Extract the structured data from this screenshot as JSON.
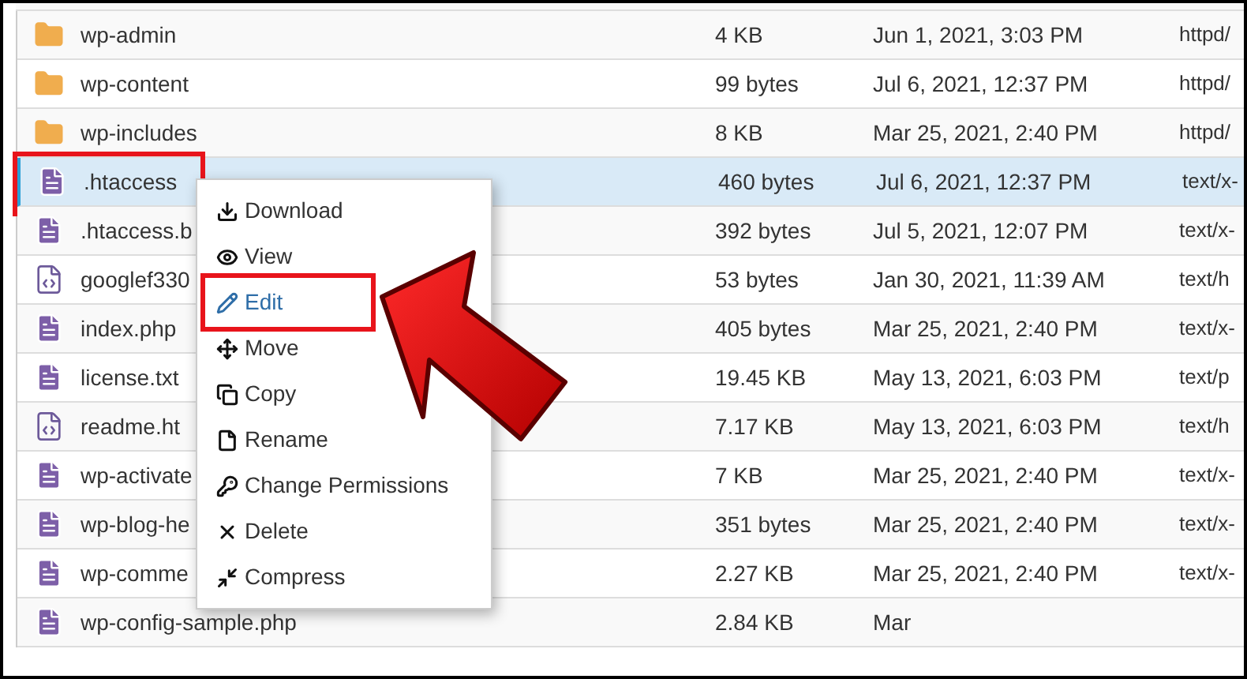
{
  "rows": [
    {
      "kind": "folder",
      "name": "wp-admin",
      "size": "4 KB",
      "date": "Jun 1, 2021, 3:03 PM",
      "type": "httpd/",
      "selected": false,
      "annotated": false
    },
    {
      "kind": "folder",
      "name": "wp-content",
      "size": "99 bytes",
      "date": "Jul 6, 2021, 12:37 PM",
      "type": "httpd/",
      "selected": false,
      "annotated": false
    },
    {
      "kind": "folder",
      "name": "wp-includes",
      "size": "8 KB",
      "date": "Mar 25, 2021, 2:40 PM",
      "type": "httpd/",
      "selected": false,
      "annotated": false
    },
    {
      "kind": "file",
      "name": ".htaccess",
      "size": "460 bytes",
      "date": "Jul 6, 2021, 12:37 PM",
      "type": "text/x-",
      "selected": true,
      "annotated": true
    },
    {
      "kind": "file",
      "name": ".htaccess.b",
      "size": "392 bytes",
      "date": "Jul 5, 2021, 12:07 PM",
      "type": "text/x-",
      "selected": false,
      "annotated": false
    },
    {
      "kind": "code",
      "name": "googlef330",
      "size": "53 bytes",
      "date": "Jan 30, 2021, 11:39 AM",
      "type": "text/h",
      "selected": false,
      "annotated": false
    },
    {
      "kind": "file",
      "name": "index.php",
      "size": "405 bytes",
      "date": "Mar 25, 2021, 2:40 PM",
      "type": "text/x-",
      "selected": false,
      "annotated": false
    },
    {
      "kind": "file",
      "name": "license.txt",
      "size": "19.45 KB",
      "date": "May 13, 2021, 6:03 PM",
      "type": "text/p",
      "selected": false,
      "annotated": false
    },
    {
      "kind": "code",
      "name": "readme.ht",
      "size": "7.17 KB",
      "date": "May 13, 2021, 6:03 PM",
      "type": "text/h",
      "selected": false,
      "annotated": false
    },
    {
      "kind": "file",
      "name": "wp-activate",
      "size": "7 KB",
      "date": "Mar 25, 2021, 2:40 PM",
      "type": "text/x-",
      "selected": false,
      "annotated": false
    },
    {
      "kind": "file",
      "name": "wp-blog-he",
      "size": "351 bytes",
      "date": "Mar 25, 2021, 2:40 PM",
      "type": "text/x-",
      "selected": false,
      "annotated": false
    },
    {
      "kind": "file",
      "name": "wp-comme",
      "size": "2.27 KB",
      "date": "Mar 25, 2021, 2:40 PM",
      "type": "text/x-",
      "selected": false,
      "annotated": false
    },
    {
      "kind": "file",
      "name": "wp-config-sample.php",
      "size": "2.84 KB",
      "date": "Mar",
      "selected": false,
      "annotated": false
    }
  ],
  "context_menu": [
    {
      "label": "Download",
      "selected": false,
      "annotated": false
    },
    {
      "label": "View",
      "selected": false,
      "annotated": false
    },
    {
      "label": "Edit",
      "selected": true,
      "annotated": true
    },
    {
      "label": "Move",
      "selected": false,
      "annotated": false
    },
    {
      "label": "Copy",
      "selected": false,
      "annotated": false
    },
    {
      "label": "Rename",
      "selected": false,
      "annotated": false
    },
    {
      "label": "Change Permissions",
      "selected": false,
      "annotated": false
    },
    {
      "label": "Delete",
      "selected": false,
      "annotated": false
    },
    {
      "label": "Compress",
      "selected": false,
      "annotated": false
    }
  ]
}
